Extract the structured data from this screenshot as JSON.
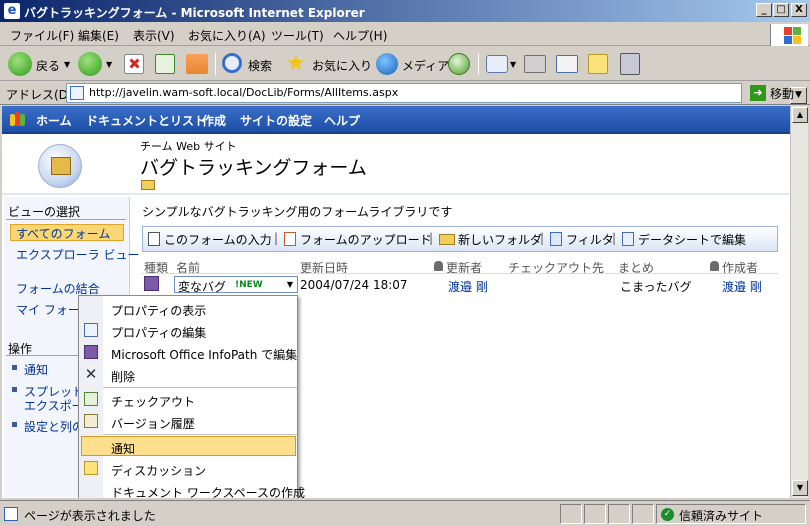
{
  "window": {
    "title": "バグトラッキングフォーム - Microsoft Internet Explorer",
    "minimize": "_",
    "maximize": "□",
    "close": "X"
  },
  "menubar": {
    "items": [
      "ファイル(F)",
      "編集(E)",
      "表示(V)",
      "お気に入り(A)",
      "ツール(T)",
      "ヘルプ(H)"
    ]
  },
  "toolbar": {
    "back_label": "戻る",
    "search_label": "検索",
    "favorites_label": "お気に入り",
    "media_label": "メディア"
  },
  "addressbar": {
    "label": "アドレス(D)",
    "url": "http://javelin.wam-soft.local/DocLib/Forms/AllItems.aspx",
    "go_label": "移動"
  },
  "topnav": {
    "items": [
      "ホーム",
      "ドキュメントとリスト",
      "作成",
      "サイトの設定",
      "ヘルプ"
    ]
  },
  "site": {
    "subtitle": "チーム Web サイト",
    "title": "バグトラッキングフォーム"
  },
  "leftnav": {
    "view_heading": "ビューの選択",
    "views": [
      "すべてのフォーム",
      "エクスプローラ ビュー",
      "フォームの結合",
      "マイ フォー"
    ],
    "actions_heading": "操作",
    "actions": [
      "通知",
      "スプレッドシ",
      "エクスポー",
      "設定と列の"
    ]
  },
  "main": {
    "description": "シンプルなバグトラッキング用のフォームライブラリです",
    "actions": [
      "このフォームの入力",
      "フォームのアップロード",
      "新しいフォルダ",
      "フィルタ",
      "データシートで編集"
    ],
    "columns": [
      "種類",
      "名前",
      "更新日時",
      "更新者",
      "チェックアウト先",
      "まとめ",
      "作成者"
    ],
    "rows": [
      {
        "name": "変なバグ",
        "badge": "!NEW",
        "modified": "2004/07/24 18:07",
        "modified_by": "渡邉 剛",
        "checked_out_to": "",
        "summary": "こまったバグ",
        "created_by": "渡邉 剛"
      }
    ]
  },
  "context_menu": {
    "items": [
      "プロパティの表示",
      "プロパティの編集",
      "Microsoft Office InfoPath で編集",
      "削除",
      "チェックアウト",
      "バージョン履歴",
      "通知",
      "ディスカッション",
      "ドキュメント ワークスペースの作成"
    ],
    "highlighted": "通知"
  },
  "statusbar": {
    "text": "ページが表示されました",
    "zone": "信頼済みサイト"
  }
}
